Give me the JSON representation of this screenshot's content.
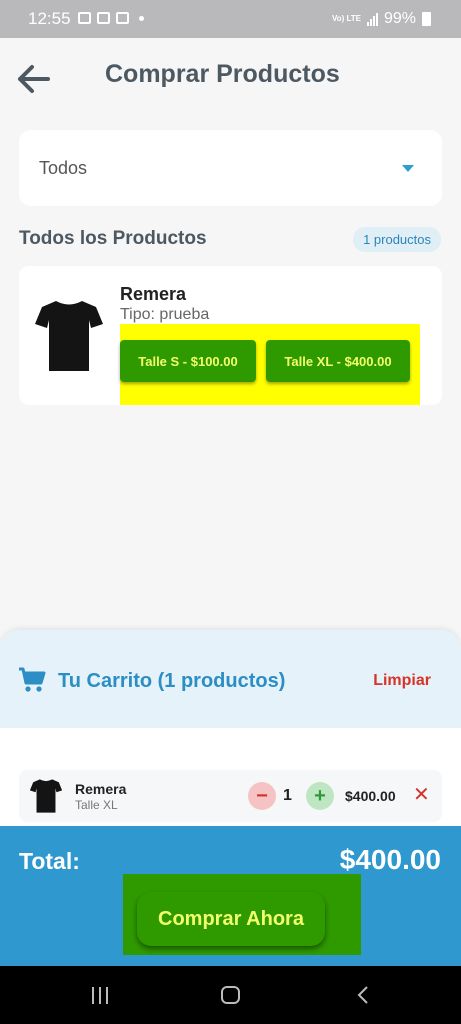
{
  "status_bar": {
    "time": "12:55",
    "network": "Vo) LTE",
    "battery": "99%"
  },
  "header": {
    "title": "Comprar Productos"
  },
  "filter": {
    "selected": "Todos"
  },
  "products_section": {
    "title": "Todos los Productos",
    "count_badge": "1 productos",
    "items": [
      {
        "name": "Remera",
        "type": "Tipo: prueba",
        "variants": [
          "Talle S - $100.00",
          "Talle XL - $400.00"
        ]
      }
    ]
  },
  "cart": {
    "title": "Tu Carrito (1 productos)",
    "clear_label": "Limpiar",
    "items": [
      {
        "name": "Remera",
        "variant": "Talle XL",
        "quantity": "1",
        "price": "$400.00"
      }
    ],
    "total_label": "Total:",
    "total_value": "$400.00",
    "buy_label": "Comprar Ahora"
  },
  "colors": {
    "primary": "#2e98cf",
    "accent_green": "#2f9a00",
    "button_text": "#f3ff6a",
    "danger": "#d6342a"
  }
}
